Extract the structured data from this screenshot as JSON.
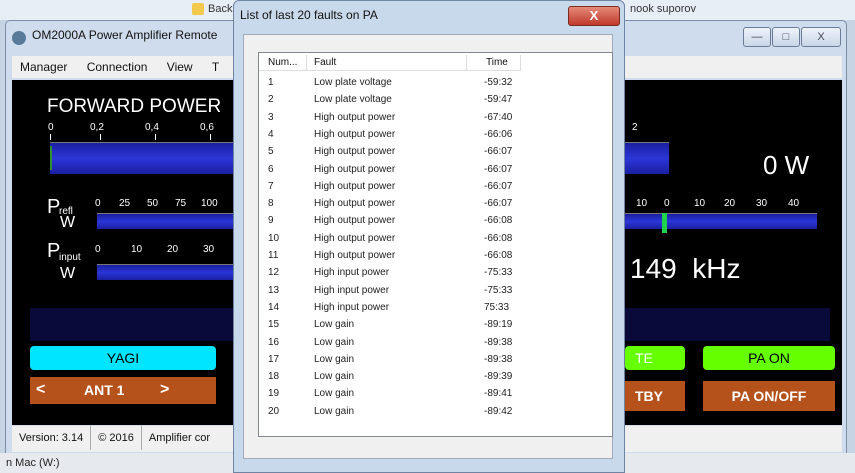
{
  "desktop": {
    "top_text": "Back",
    "top_right_text": "nook suporov",
    "bottom_text": "n Mac (W:)"
  },
  "main_window": {
    "title": "OM2000A Power Amplifier Remote",
    "menu": [
      "Manager",
      "Connection",
      "View",
      "T"
    ],
    "forward_power": {
      "label": "FORWARD POWER",
      "scale": [
        "0",
        "0,2",
        "0,4",
        "0,6"
      ],
      "scale_right": "2",
      "value": "0 W"
    },
    "refl": {
      "label_main": "P",
      "label_sub": "refl",
      "unit": "W",
      "scale": [
        "0",
        "25",
        "50",
        "75",
        "100"
      ]
    },
    "input": {
      "label_main": "P",
      "label_sub": "input",
      "unit": "W",
      "scale": [
        "0",
        "10",
        "20",
        "30"
      ]
    },
    "tune_scale": [
      "10",
      "0",
      "10",
      "20",
      "30",
      "40"
    ],
    "frequency": "149  kHz",
    "buttons": {
      "antenna_name": "YAGI",
      "ant_prev": "<",
      "ant_label": "ANT 1",
      "ant_next": ">",
      "operate": "TE",
      "pa_on": "PA ON",
      "standby": "TBY",
      "pa_onoff": "PA ON/OFF"
    },
    "status": {
      "version": "Version: 3.14",
      "copyright": "© 2016",
      "amp": "Amplifier cor"
    },
    "colors": {
      "bar": "#2b36d8",
      "cyan": "#00e5ff",
      "green": "#66ff00",
      "orange": "#b5521b",
      "background": "#000000"
    }
  },
  "dialog": {
    "title": "List of last 20 faults on PA",
    "close": "X",
    "columns": [
      "Num...",
      "Fault",
      "Time"
    ],
    "rows": [
      [
        "1",
        "Low plate voltage",
        "-59:32"
      ],
      [
        "2",
        "Low plate voltage",
        "-59:47"
      ],
      [
        "3",
        "High output power",
        "-67:40"
      ],
      [
        "4",
        "High output power",
        "-66:06"
      ],
      [
        "5",
        "High output power",
        "-66:07"
      ],
      [
        "6",
        "High output power",
        "-66:07"
      ],
      [
        "7",
        "High output power",
        "-66:07"
      ],
      [
        "8",
        "High output power",
        "-66:07"
      ],
      [
        "9",
        "High output power",
        "-66:08"
      ],
      [
        "10",
        "High output power",
        "-66:08"
      ],
      [
        "11",
        "High output power",
        "-66:08"
      ],
      [
        "12",
        "High input power",
        "-75:33"
      ],
      [
        "13",
        "High input power",
        "-75:33"
      ],
      [
        "14",
        "High input power",
        "75:33"
      ],
      [
        "15",
        "Low gain",
        "-89:19"
      ],
      [
        "16",
        "Low gain",
        "-89:38"
      ],
      [
        "17",
        "Low gain",
        "-89:38"
      ],
      [
        "18",
        "Low gain",
        "-89:39"
      ],
      [
        "19",
        "Low gain",
        "-89:41"
      ],
      [
        "20",
        "Low gain",
        "-89:42"
      ]
    ]
  }
}
